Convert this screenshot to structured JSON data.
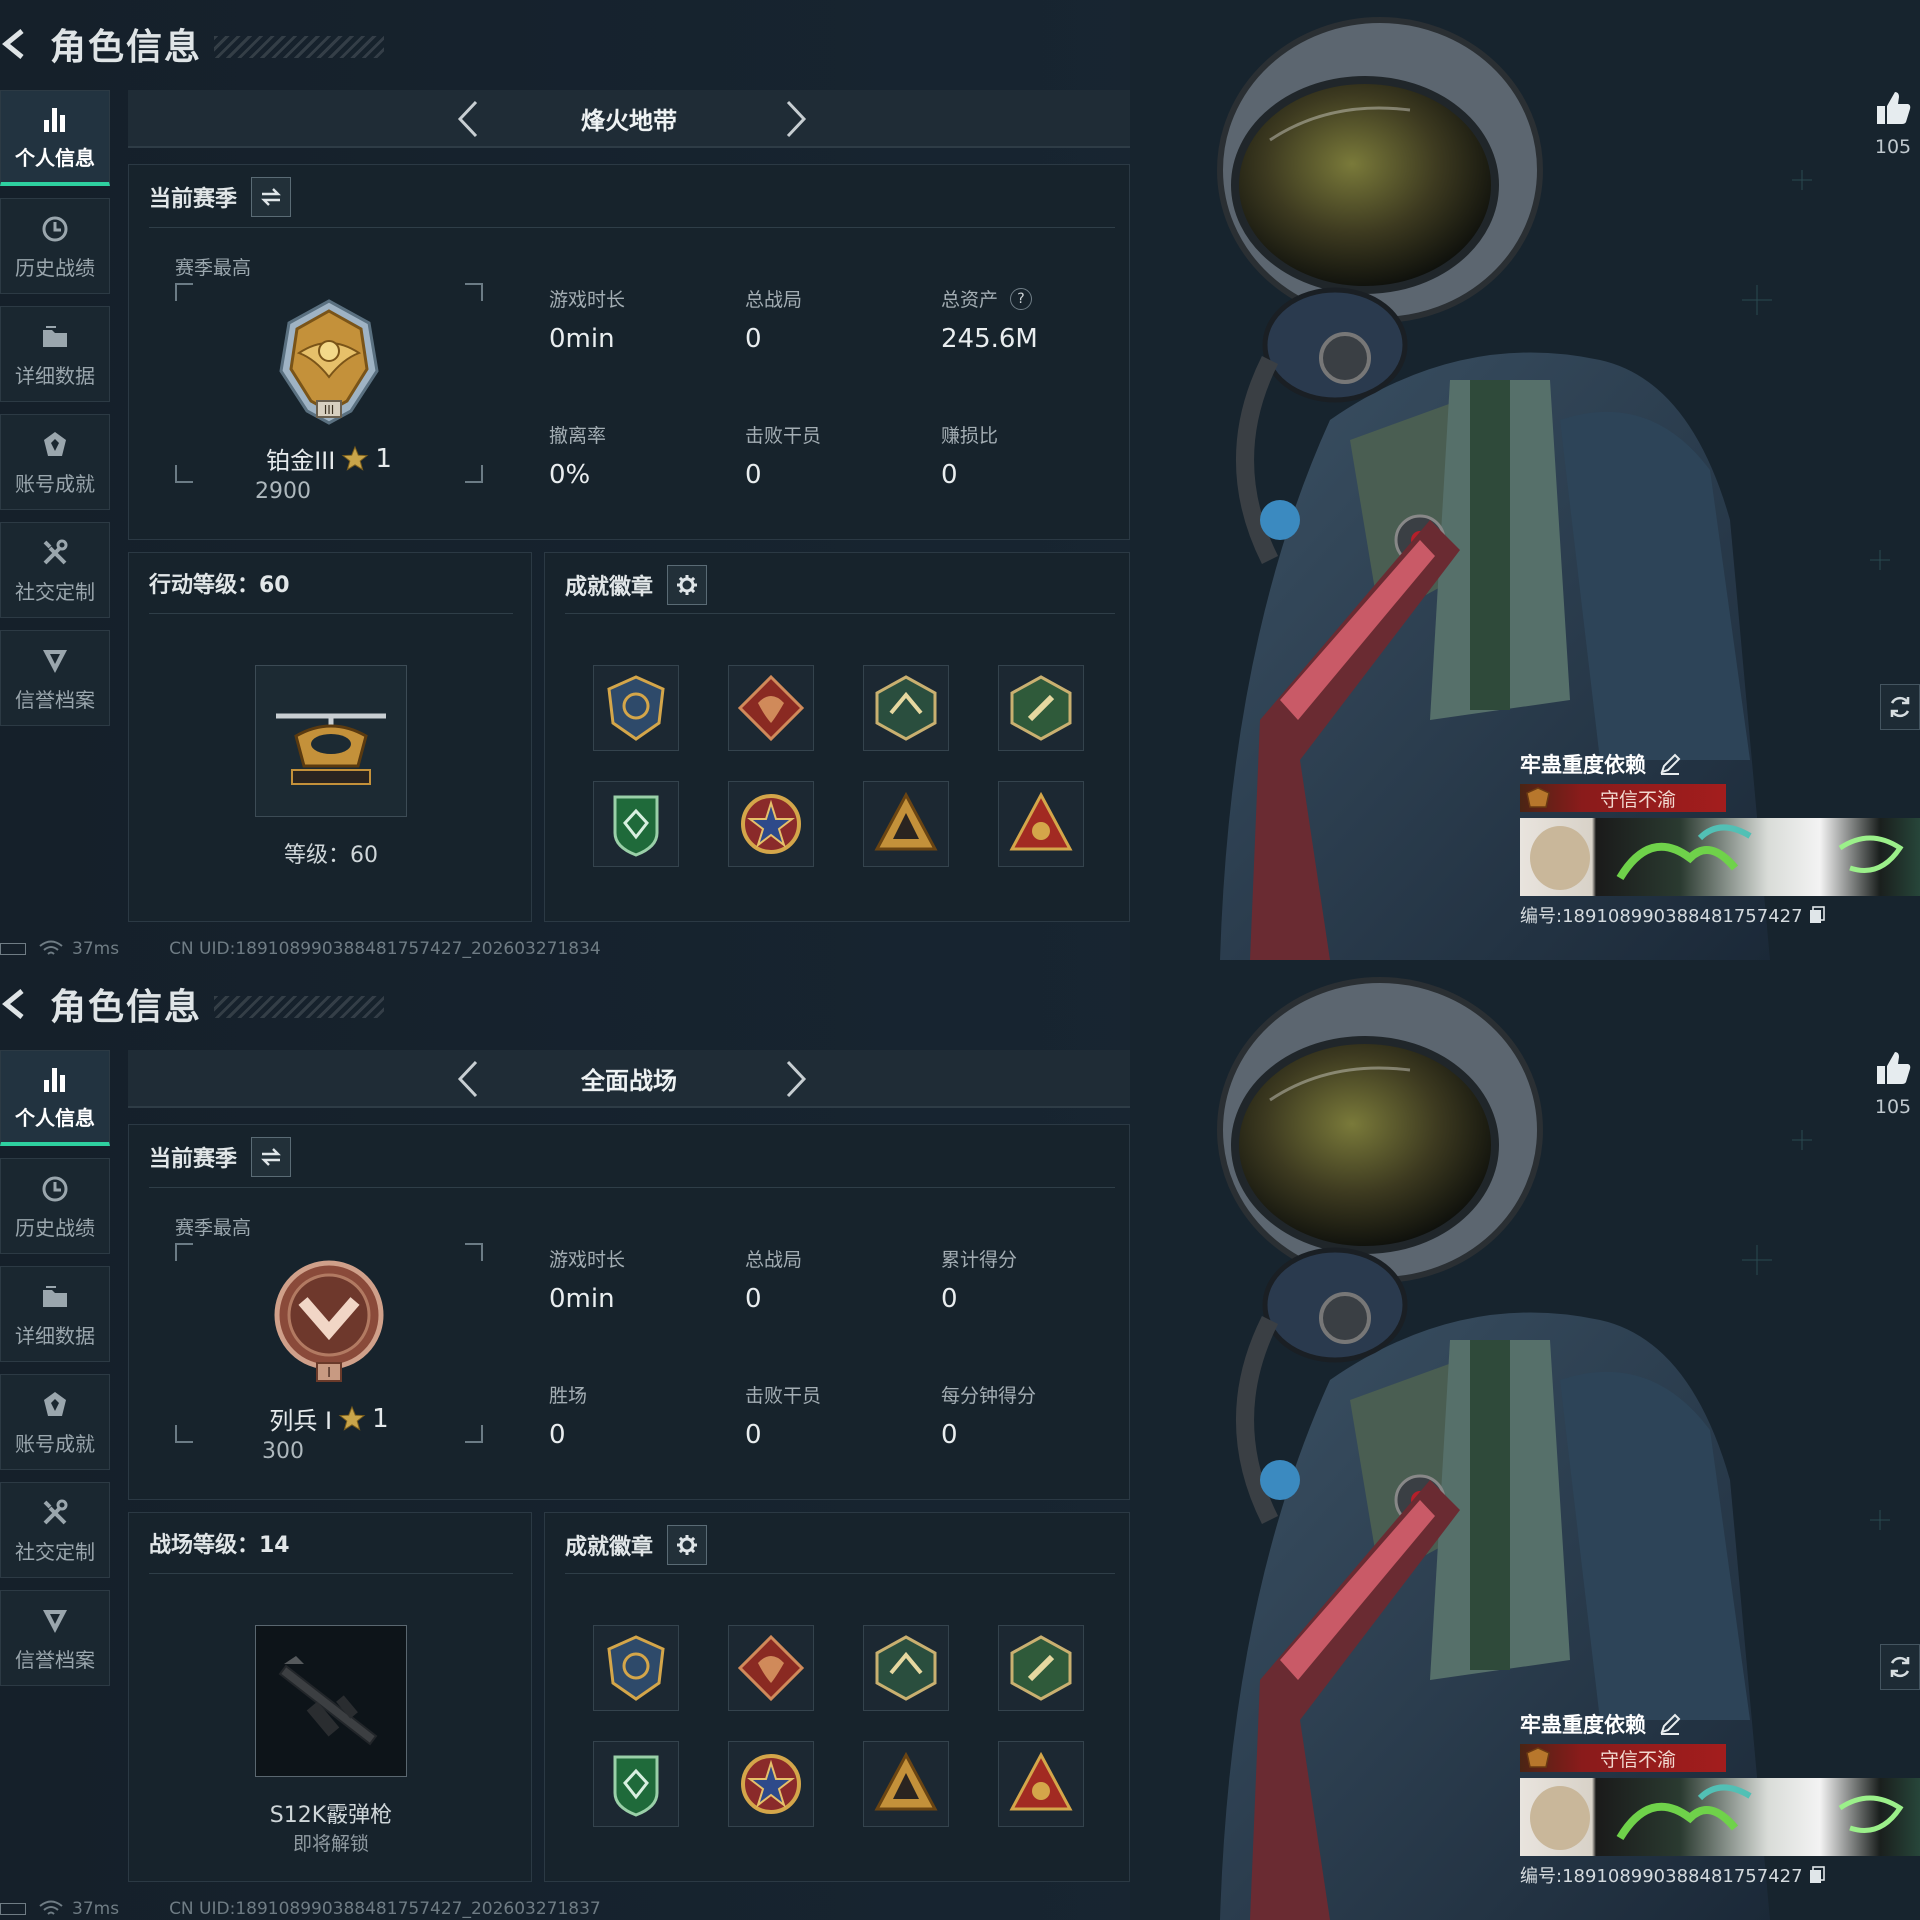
{
  "colors": {
    "accent": "#2ed0a0",
    "title_red": "#a31d1d",
    "bg": "#15202a"
  },
  "panels": [
    {
      "header": {
        "title": "角色信息"
      },
      "sidebar": [
        {
          "label": "个人信息",
          "icon": "bar-chart-icon",
          "active": true
        },
        {
          "label": "历史战绩",
          "icon": "history-clock-icon",
          "active": false
        },
        {
          "label": "详细数据",
          "icon": "folder-icon",
          "active": false
        },
        {
          "label": "账号成就",
          "icon": "achievement-icon",
          "active": false
        },
        {
          "label": "社交定制",
          "icon": "tools-icon",
          "active": false
        },
        {
          "label": "信誉档案",
          "icon": "credit-shield-icon",
          "active": false
        }
      ],
      "mode": "烽火地带",
      "season": {
        "title": "当前赛季",
        "peak_label": "赛季最高",
        "rank_name": "铂金III",
        "rank_stars": "1",
        "rank_score": "2900",
        "stats": [
          {
            "label": "游戏时长",
            "value": "0min"
          },
          {
            "label": "总战局",
            "value": "0"
          },
          {
            "label": "总资产",
            "value": "245.6M",
            "help": "?"
          },
          {
            "label": "撤离率",
            "value": "0%"
          },
          {
            "label": "击败干员",
            "value": "0"
          },
          {
            "label": "赚损比",
            "value": "0"
          }
        ]
      },
      "level_box": {
        "title": "行动等级：60",
        "text": "等级：60",
        "sub": ""
      },
      "badges": {
        "title": "成就徽章"
      },
      "footer": {
        "ping": "37ms",
        "uid": "CN UID:18910899038848175742​7_202603271834"
      },
      "likes": "105",
      "profile": {
        "name": "牢蛊重度依赖",
        "title": "守信不渝",
        "id": "编号:18910899038848175742​7"
      }
    },
    {
      "header": {
        "title": "角色信息"
      },
      "sidebar": [
        {
          "label": "个人信息",
          "icon": "bar-chart-icon",
          "active": true
        },
        {
          "label": "历史战绩",
          "icon": "history-clock-icon",
          "active": false
        },
        {
          "label": "详细数据",
          "icon": "folder-icon",
          "active": false
        },
        {
          "label": "账号成就",
          "icon": "achievement-icon",
          "active": false
        },
        {
          "label": "社交定制",
          "icon": "tools-icon",
          "active": false
        },
        {
          "label": "信誉档案",
          "icon": "credit-shield-icon",
          "active": false
        }
      ],
      "mode": "全面战场",
      "season": {
        "title": "当前赛季",
        "peak_label": "赛季最高",
        "rank_name": "列兵 I",
        "rank_stars": "1",
        "rank_score": "300",
        "stats": [
          {
            "label": "游戏时长",
            "value": "0min"
          },
          {
            "label": "总战局",
            "value": "0"
          },
          {
            "label": "累计得分",
            "value": "0"
          },
          {
            "label": "胜场",
            "value": "0"
          },
          {
            "label": "击败干员",
            "value": "0"
          },
          {
            "label": "每分钟得分",
            "value": "0"
          }
        ]
      },
      "level_box": {
        "title": "战场等级：14",
        "text": "S12K霰弹枪",
        "sub": "即将解锁"
      },
      "badges": {
        "title": "成就徽章"
      },
      "footer": {
        "ping": "37ms",
        "uid": "CN UID:18910899038848175742​7_202603271837"
      },
      "likes": "105",
      "profile": {
        "name": "牢蛊重度依赖",
        "title": "守信不渝",
        "id": "编号:18910899038848175742​7"
      }
    }
  ]
}
